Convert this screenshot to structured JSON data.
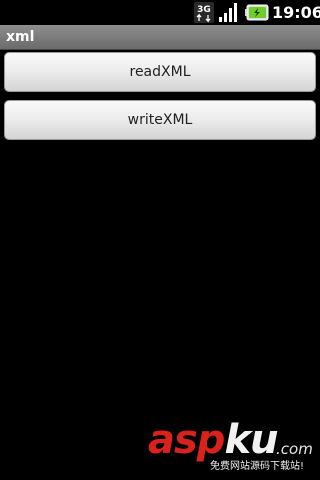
{
  "status_bar": {
    "network": "3G",
    "icons": [
      "3g-data-icon",
      "signal-strength-icon",
      "battery-charging-icon"
    ],
    "time": "19:06"
  },
  "title_bar": {
    "title": "xml"
  },
  "buttons": {
    "read_label": "readXML",
    "write_label": "writeXML"
  },
  "watermark": {
    "brand_part1": "asp",
    "brand_part2": "ku",
    "domain_suffix": ".com",
    "tagline": "免费网站源码下载站!"
  },
  "colors": {
    "background": "#000000",
    "title_bar": "#7d7d7d",
    "watermark_red": "#d9221b",
    "battery_green": "#6fcf28"
  }
}
